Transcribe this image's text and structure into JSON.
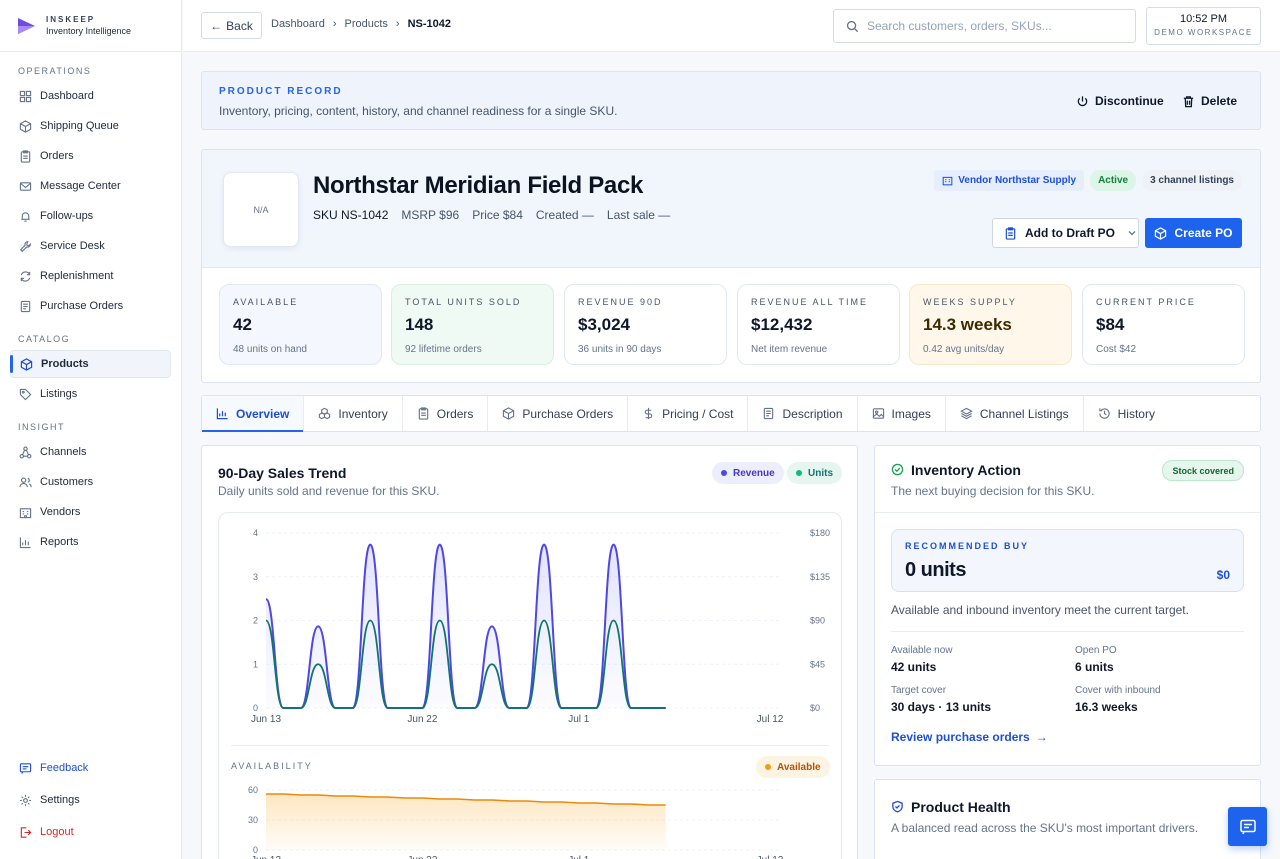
{
  "brand": {
    "name": "INSKEEP",
    "tagline": "Inventory Intelligence"
  },
  "sidebar": {
    "sections": [
      {
        "label": "OPERATIONS",
        "items": [
          {
            "label": "Dashboard",
            "icon": "grid-icon"
          },
          {
            "label": "Shipping Queue",
            "icon": "box-icon"
          },
          {
            "label": "Orders",
            "icon": "clipboard-icon"
          },
          {
            "label": "Message Center",
            "icon": "mail-icon"
          },
          {
            "label": "Follow-ups",
            "icon": "bell-icon"
          },
          {
            "label": "Service Desk",
            "icon": "wrench-icon"
          },
          {
            "label": "Replenishment",
            "icon": "refresh-icon"
          },
          {
            "label": "Purchase Orders",
            "icon": "document-icon"
          }
        ]
      },
      {
        "label": "CATALOG",
        "items": [
          {
            "label": "Products",
            "icon": "cube-icon",
            "active": true
          },
          {
            "label": "Listings",
            "icon": "tag-icon"
          }
        ]
      },
      {
        "label": "INSIGHT",
        "items": [
          {
            "label": "Channels",
            "icon": "network-icon"
          },
          {
            "label": "Customers",
            "icon": "users-icon"
          },
          {
            "label": "Vendors",
            "icon": "building-icon"
          },
          {
            "label": "Reports",
            "icon": "bar-chart-icon"
          }
        ]
      }
    ],
    "bottom": [
      {
        "label": "Feedback",
        "icon": "message-icon",
        "color": "#1d4ed8"
      },
      {
        "label": "Settings",
        "icon": "gear-icon",
        "color": "#1e293b"
      },
      {
        "label": "Logout",
        "icon": "logout-icon",
        "color": "#dc2626"
      }
    ]
  },
  "topbar": {
    "back_label": "Back",
    "breadcrumb": [
      "Dashboard",
      "Products",
      "NS-1042"
    ],
    "search_placeholder": "Search customers, orders, SKUs...",
    "time": "10:52 PM",
    "workspace": "DEMO WORKSPACE"
  },
  "record": {
    "label": "PRODUCT RECORD",
    "description": "Inventory, pricing, content, history, and channel readiness for a single SKU.",
    "discontinue_label": "Discontinue",
    "delete_label": "Delete"
  },
  "product": {
    "thumb": "N/A",
    "name": "Northstar Meridian Field Pack",
    "sku": "SKU NS-1042",
    "msrp": "MSRP $96",
    "price": "Price $84",
    "created": "Created —",
    "last_sale": "Last sale —",
    "vendor_badge": "Vendor Northstar Supply",
    "status_badge": "Active",
    "channels_badge": "3 channel listings",
    "add_draft_label": "Add to Draft PO",
    "create_po_label": "Create PO"
  },
  "stats": [
    {
      "label": "AVAILABLE",
      "value": "42",
      "sub": "48 units on hand"
    },
    {
      "label": "TOTAL UNITS SOLD",
      "value": "148",
      "sub": "92 lifetime orders"
    },
    {
      "label": "REVENUE 90D",
      "value": "$3,024",
      "sub": "36 units in 90 days"
    },
    {
      "label": "REVENUE ALL TIME",
      "value": "$12,432",
      "sub": "Net item revenue"
    },
    {
      "label": "WEEKS SUPPLY",
      "value": "14.3 weeks",
      "sub": "0.42 avg units/day"
    },
    {
      "label": "CURRENT PRICE",
      "value": "$84",
      "sub": "Cost $42"
    }
  ],
  "tabs": [
    {
      "label": "Overview",
      "icon": "bar-chart-icon",
      "active": true
    },
    {
      "label": "Inventory",
      "icon": "boxes-icon"
    },
    {
      "label": "Orders",
      "icon": "clipboard-icon"
    },
    {
      "label": "Purchase Orders",
      "icon": "cube-icon"
    },
    {
      "label": "Pricing / Cost",
      "icon": "dollar-icon"
    },
    {
      "label": "Description",
      "icon": "document-icon"
    },
    {
      "label": "Images",
      "icon": "image-icon"
    },
    {
      "label": "Channel Listings",
      "icon": "layers-icon"
    },
    {
      "label": "History",
      "icon": "history-icon"
    }
  ],
  "sales_panel": {
    "title": "90-Day Sales Trend",
    "subtitle": "Daily units sold and revenue for this SKU.",
    "legend_revenue": "Revenue",
    "legend_units": "Units",
    "availability_label": "AVAILABILITY",
    "legend_available": "Available"
  },
  "chart_data": [
    {
      "type": "line",
      "x": [
        "Jun 13",
        "Jun 14",
        "Jun 15",
        "Jun 16",
        "Jun 17",
        "Jun 18",
        "Jun 19",
        "Jun 20",
        "Jun 21",
        "Jun 22",
        "Jun 23",
        "Jun 24",
        "Jun 25",
        "Jun 26",
        "Jun 27",
        "Jun 28",
        "Jun 29",
        "Jun 30",
        "Jul 1",
        "Jul 2",
        "Jul 3",
        "Jul 4",
        "Jul 5",
        "Jul 6",
        "Jul 7",
        "Jul 8",
        "Jul 9",
        "Jul 10",
        "Jul 11",
        "Jul 12"
      ],
      "x_tick_labels": [
        "Jun 13",
        "Jun 22",
        "Jul 1",
        "Jul 12"
      ],
      "y_left_ticks": [
        0,
        1,
        2,
        3,
        4
      ],
      "y_right_ticks": [
        "$0",
        "$45",
        "$90",
        "$135",
        "$180"
      ],
      "ylim_left": [
        0,
        4
      ],
      "ylim_right": [
        0,
        180
      ],
      "series": [
        {
          "name": "Revenue",
          "axis": "right",
          "color": "#4f46e5",
          "values": [
            112,
            0,
            0,
            84,
            0,
            0,
            168,
            0,
            0,
            0,
            168,
            0,
            0,
            84,
            0,
            0,
            168,
            0,
            0,
            0,
            168,
            0,
            0,
            0,
            0,
            0,
            0,
            0,
            0,
            0
          ]
        },
        {
          "name": "Units",
          "axis": "left",
          "color": "#0f766e",
          "values": [
            2,
            0,
            0,
            1,
            0,
            0,
            2,
            0,
            0,
            0,
            2,
            0,
            0,
            1,
            0,
            0,
            2,
            0,
            0,
            0,
            2,
            0,
            0,
            0,
            0,
            0,
            0,
            0,
            0,
            0
          ]
        }
      ],
      "data_end_index": 23
    },
    {
      "type": "area",
      "title": "AVAILABILITY",
      "x_tick_labels": [
        "Jun 13",
        "Jun 22",
        "Jul 1",
        "Jul 12"
      ],
      "y_ticks": [
        0,
        30,
        60
      ],
      "ylim": [
        0,
        60
      ],
      "series": [
        {
          "name": "Available",
          "color": "#ea8a0c",
          "values": [
            56,
            56,
            55,
            55,
            54,
            54,
            53,
            53,
            52,
            52,
            51,
            51,
            50,
            50,
            49,
            49,
            48,
            48,
            47,
            47,
            46,
            46,
            45,
            45
          ]
        }
      ]
    }
  ],
  "inventory_action": {
    "title": "Inventory Action",
    "subtitle": "The next buying decision for this SKU.",
    "chip": "Stock covered",
    "rec_label": "RECOMMENDED BUY",
    "rec_value": "0 units",
    "rec_price": "$0",
    "note": "Available and inbound inventory meet the current target.",
    "kv": [
      {
        "k": "Available now",
        "v": "42 units"
      },
      {
        "k": "Open PO",
        "v": "6 units"
      },
      {
        "k": "Target cover",
        "v": "30 days · 13 units"
      },
      {
        "k": "Cover with inbound",
        "v": "16.3 weeks"
      }
    ],
    "review_link": "Review purchase orders"
  },
  "health": {
    "title": "Product Health",
    "subtitle": "A balanced read across the SKU's most important drivers."
  },
  "colors": {
    "accent": "#1d63ed",
    "revenue": "#4f46e5",
    "units": "#0f766e",
    "available": "#ea8a0c"
  }
}
